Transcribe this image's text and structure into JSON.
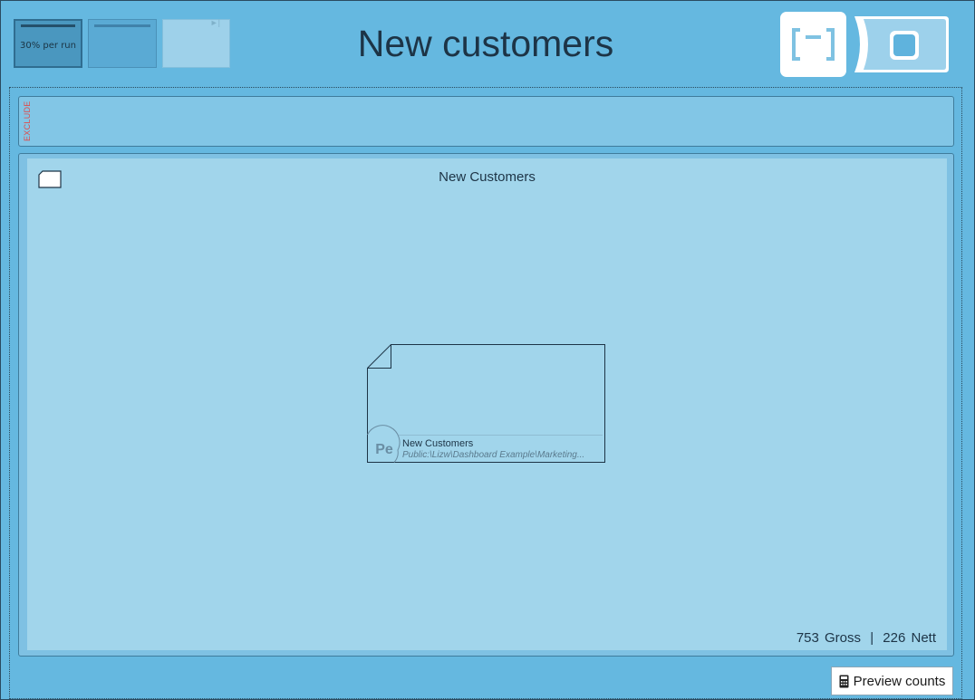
{
  "header": {
    "title": "New customers",
    "thumbnails": [
      {
        "label": "30% per run"
      },
      {
        "label": ""
      },
      {
        "label": ""
      }
    ]
  },
  "exclude_panel": {
    "label": "EXCLUDE"
  },
  "main_panel": {
    "title": "New Customers",
    "card": {
      "badge": "Pe",
      "name": "New Customers",
      "path": "Public:\\Lizw\\Dashboard Example\\Marketing..."
    },
    "counts": {
      "gross_value": "753",
      "gross_label": "Gross",
      "separator": "|",
      "nett_value": "226",
      "nett_label": "Nett"
    }
  },
  "footer": {
    "preview_label": "Preview counts"
  },
  "colors": {
    "background": "#65b8e0",
    "panel": "#a1d5eb",
    "exclude_text": "#e04b4b",
    "title_text": "#1d3446"
  }
}
